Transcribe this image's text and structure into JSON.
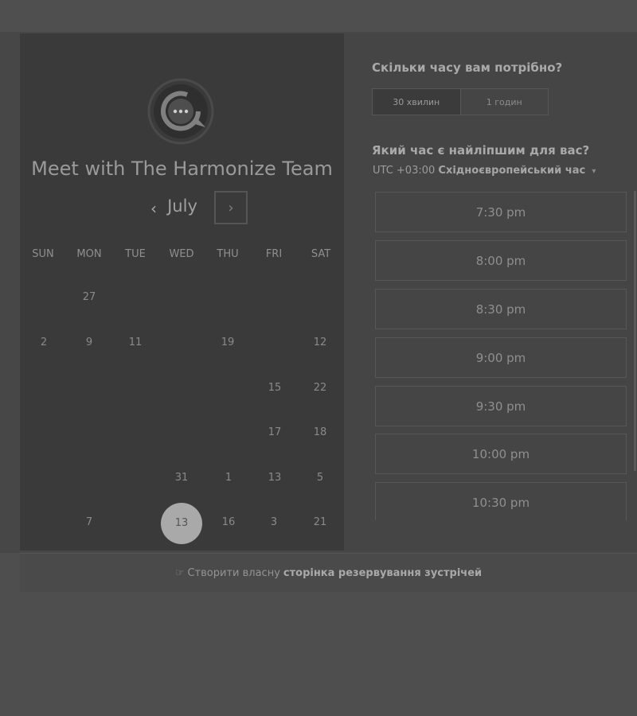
{
  "header": {
    "title": "Meet with The Harmonize Team",
    "logo_icon": "chat-bubble-icon"
  },
  "calendar": {
    "month": "July",
    "prev_icon": "chevron-left-icon",
    "next_icon": "chevron-right-icon",
    "weekdays": [
      "SUN",
      "MON",
      "TUE",
      "WED",
      "THU",
      "FRI",
      "SAT"
    ],
    "days": [
      {
        "label": "27"
      },
      {
        "label": "2"
      },
      {
        "label": "9"
      },
      {
        "label": "11"
      },
      {
        "label": "19"
      },
      {
        "label": "12"
      },
      {
        "label": "15"
      },
      {
        "label": "22"
      },
      {
        "label": "17"
      },
      {
        "label": "18"
      },
      {
        "label": "31"
      },
      {
        "label": "1"
      },
      {
        "label": "13"
      },
      {
        "label": "5"
      },
      {
        "label": "7"
      },
      {
        "label": "13",
        "selected": true
      },
      {
        "label": "16"
      },
      {
        "label": "3"
      },
      {
        "label": "21"
      }
    ]
  },
  "duration": {
    "question": "Скільки часу вам потрібно?",
    "options": [
      "30 хвилин",
      "1 годин"
    ],
    "selected": "30 хвилин"
  },
  "timeslots": {
    "question": "Який час є найліпшим для вас?",
    "timezone_prefix": "UTC +03:00",
    "timezone_name": "Східноєвропейський час",
    "slots": [
      "7:30 pm",
      "8:00 pm",
      "8:30 pm",
      "9:00 pm",
      "9:30 pm",
      "10:00 pm",
      "10:30 pm"
    ]
  },
  "footer": {
    "text": "Створити власну",
    "bold": "сторінка резервування зустрічей"
  },
  "colors": {
    "panel_dark": "#3a3a3a",
    "panel_light": "#454545",
    "selected_day": "#a9a9a9"
  }
}
